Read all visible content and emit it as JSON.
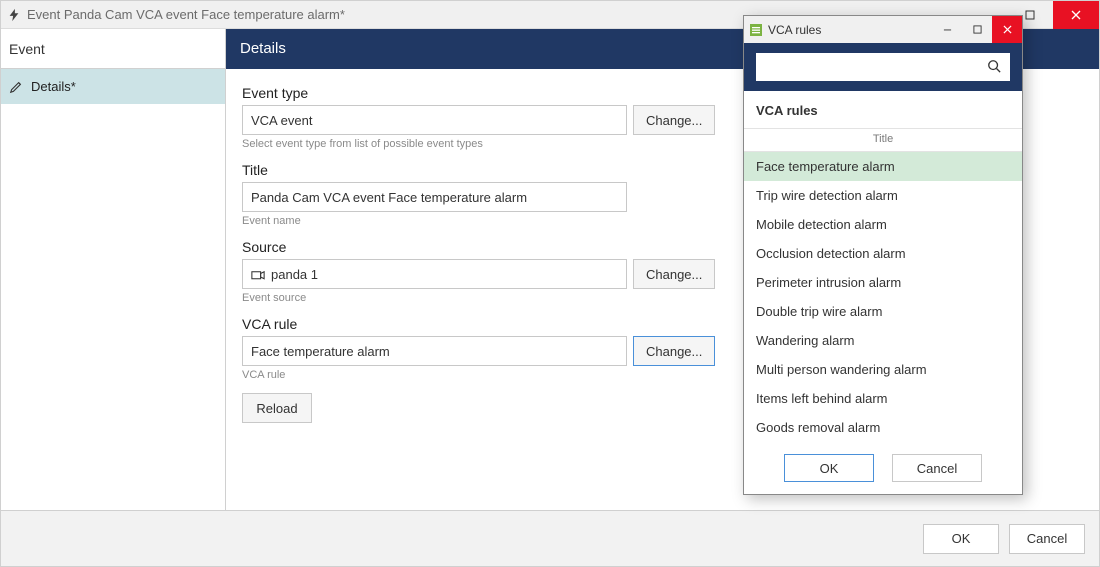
{
  "titlebar": {
    "title": "Event Panda Cam VCA event Face temperature alarm*"
  },
  "sidebar": {
    "header": "Event",
    "items": [
      {
        "label": "Details*"
      }
    ]
  },
  "details": {
    "header": "Details",
    "event_type": {
      "label": "Event type",
      "value": "VCA event",
      "hint": "Select event type from list of possible event types",
      "change": "Change..."
    },
    "title_field": {
      "label": "Title",
      "value": "Panda Cam VCA event Face temperature alarm",
      "hint": "Event name"
    },
    "source": {
      "label": "Source",
      "value": "panda 1",
      "hint": "Event source",
      "change": "Change..."
    },
    "vca_rule": {
      "label": "VCA rule",
      "value": "Face temperature alarm",
      "hint": "VCA rule",
      "change": "Change..."
    },
    "reload": "Reload"
  },
  "footer": {
    "ok": "OK",
    "cancel": "Cancel"
  },
  "modal": {
    "title": "VCA rules",
    "search_placeholder": "",
    "caption": "VCA rules",
    "col_header": "Title",
    "selected_index": 0,
    "rows": [
      "Face temperature alarm",
      "Trip wire detection alarm",
      "Mobile detection alarm",
      "Occlusion detection alarm",
      "Perimeter intrusion alarm",
      "Double trip wire alarm",
      "Wandering alarm",
      "Multi person wandering alarm",
      "Items left behind alarm",
      "Goods removal alarm"
    ],
    "ok": "OK",
    "cancel": "Cancel"
  }
}
